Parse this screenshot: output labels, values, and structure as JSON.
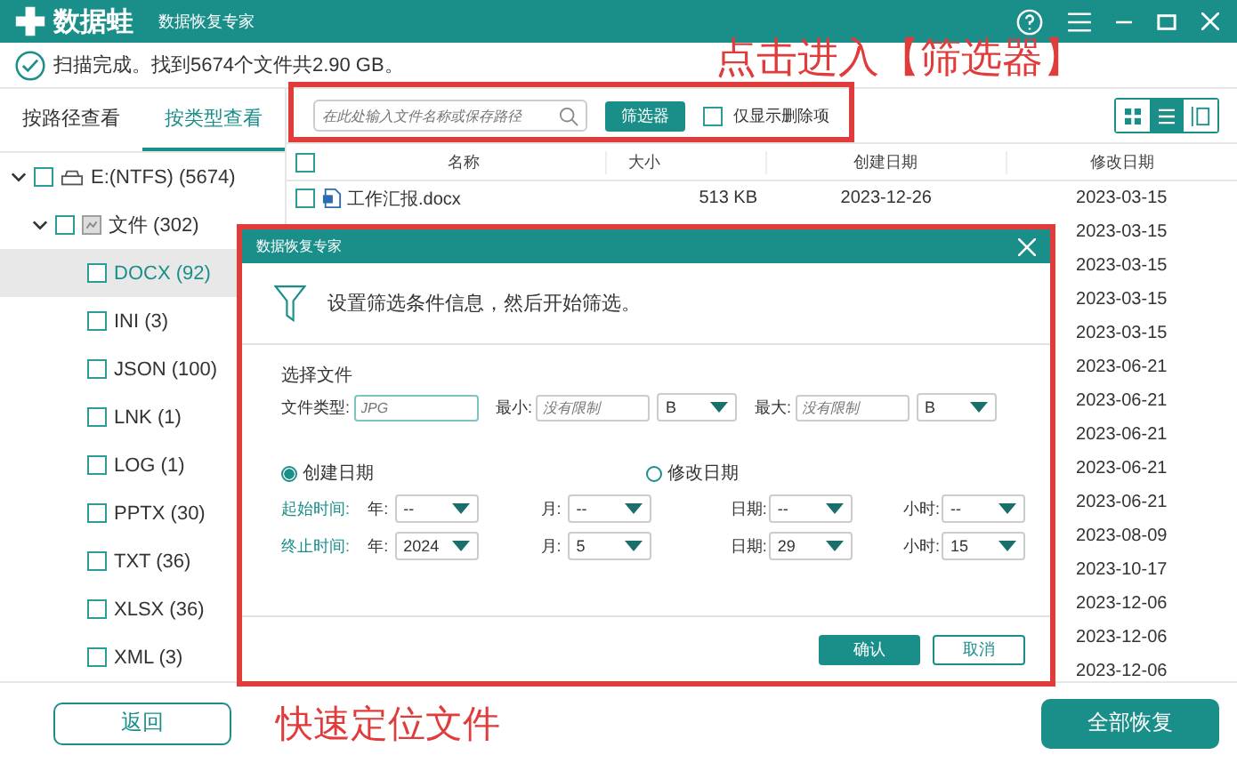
{
  "window": {
    "logo": "数据蛙",
    "subtitle": "数据恢复专家"
  },
  "scan_status": "扫描完成。找到5674个文件共2.90 GB。",
  "sidebar": {
    "tabs": [
      {
        "label": "按路径查看",
        "selected": false
      },
      {
        "label": "按类型查看",
        "selected": true
      }
    ],
    "tree": [
      {
        "label": "E:(NTFS) (5674)",
        "kind": "drive",
        "checked": false,
        "expanded": true,
        "selected": false,
        "children": [
          {
            "label": "文件 (302)",
            "kind": "folder",
            "checked": false,
            "expanded": true,
            "selected": false,
            "children": [
              {
                "label": "DOCX (92)",
                "checked": false,
                "selected": true
              },
              {
                "label": "INI (3)",
                "checked": false,
                "selected": false
              },
              {
                "label": "JSON (100)",
                "checked": false,
                "selected": false
              },
              {
                "label": "LNK (1)",
                "checked": false,
                "selected": false
              },
              {
                "label": "LOG (1)",
                "checked": false,
                "selected": false
              },
              {
                "label": "PPTX (30)",
                "checked": false,
                "selected": false
              },
              {
                "label": "TXT (36)",
                "checked": false,
                "selected": false
              },
              {
                "label": "XLSX (36)",
                "checked": false,
                "selected": false
              },
              {
                "label": "XML (3)",
                "checked": false,
                "selected": false
              }
            ]
          }
        ]
      }
    ],
    "back_button": "返回"
  },
  "toolbar": {
    "search": {
      "placeholder": "在此处输入文件名称或保存路径"
    },
    "filter_button": "筛选器",
    "deleted_only": {
      "label": "仅显示删除项",
      "checked": false
    },
    "views": [
      {
        "kind": "grid",
        "selected": false
      },
      {
        "kind": "list",
        "selected": true
      },
      {
        "kind": "preview",
        "selected": false
      }
    ]
  },
  "table": {
    "columns": [
      "名称",
      "大小",
      "创建日期",
      "修改日期"
    ],
    "all_checked": false,
    "rows": [
      {
        "name": "工作汇报.docx",
        "size": "513 KB",
        "created": "2023-12-26",
        "modified": "2023-03-15",
        "checked": false
      },
      {
        "modified": "2023-03-15"
      },
      {
        "modified": "2023-03-15"
      },
      {
        "modified": "2023-03-15"
      },
      {
        "modified": "2023-03-15"
      },
      {
        "modified": "2023-06-21"
      },
      {
        "modified": "2023-06-21"
      },
      {
        "modified": "2023-06-21"
      },
      {
        "modified": "2023-06-21"
      },
      {
        "modified": "2023-06-21"
      },
      {
        "modified": "2023-08-09"
      },
      {
        "modified": "2023-10-17"
      },
      {
        "modified": "2023-12-06"
      },
      {
        "modified": "2023-12-06"
      },
      {
        "modified": "2023-12-06"
      }
    ]
  },
  "recover_all_button": "全部恢复",
  "dialog": {
    "title": "数据恢复专家",
    "message": "设置筛选条件信息，然后开始筛选。",
    "section": "选择文件",
    "file_type": {
      "label": "文件类型:",
      "placeholder": "JPG"
    },
    "min": {
      "label": "最小:",
      "placeholder": "没有限制",
      "unit": "B"
    },
    "max": {
      "label": "最大:",
      "placeholder": "没有限制",
      "unit": "B"
    },
    "date_modes": [
      {
        "label": "创建日期",
        "selected": true
      },
      {
        "label": "修改日期",
        "selected": false
      }
    ],
    "ranges": [
      {
        "label": "起始时间:",
        "fields": [
          {
            "label": "年:",
            "value": "--"
          },
          {
            "label": "月:",
            "value": "--"
          },
          {
            "label": "日期:",
            "value": "--"
          },
          {
            "label": "小时:",
            "value": "--"
          }
        ]
      },
      {
        "label": "终止时间:",
        "fields": [
          {
            "label": "年:",
            "value": "2024"
          },
          {
            "label": "月:",
            "value": "5"
          },
          {
            "label": "日期:",
            "value": "29"
          },
          {
            "label": "小时:",
            "value": "15"
          }
        ]
      }
    ],
    "confirm": "确认",
    "cancel": "取消"
  },
  "annotations": [
    {
      "text": "点击进入【筛选器】"
    },
    {
      "text": "快速定位文件"
    }
  ]
}
